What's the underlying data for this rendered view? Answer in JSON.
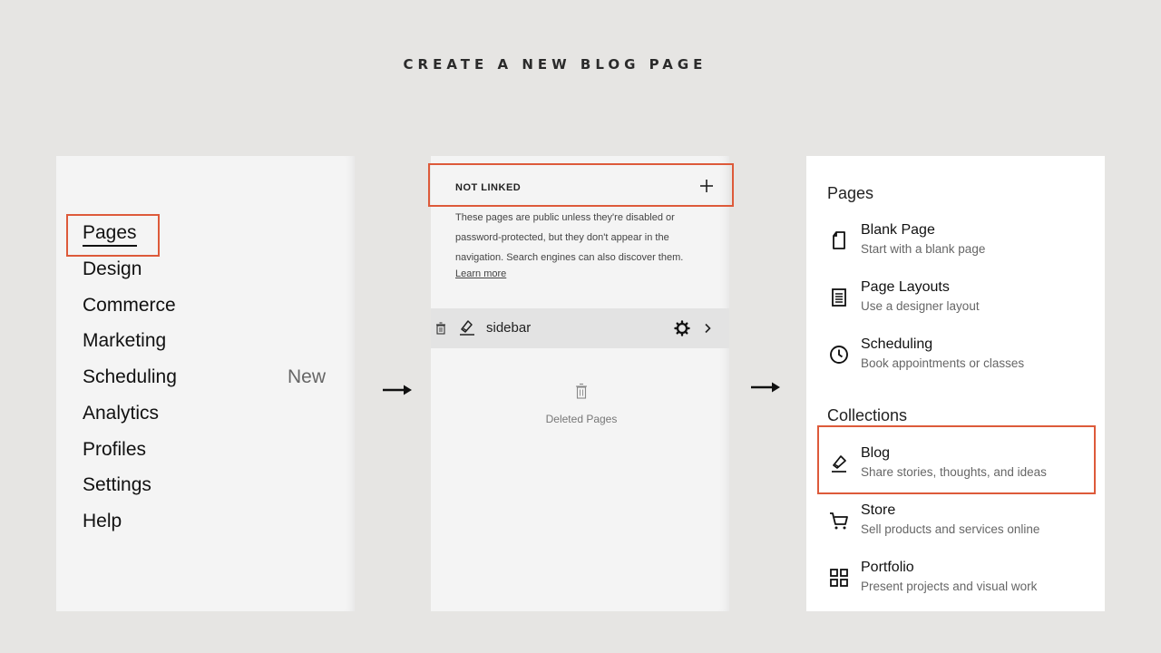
{
  "header": {
    "title": "CREATE A NEW BLOG PAGE"
  },
  "panel1": {
    "nav": [
      {
        "label": "Pages"
      },
      {
        "label": "Design"
      },
      {
        "label": "Commerce"
      },
      {
        "label": "Marketing"
      },
      {
        "label": "Scheduling",
        "badge": "New"
      },
      {
        "label": "Analytics"
      },
      {
        "label": "Profiles"
      },
      {
        "label": "Settings"
      },
      {
        "label": "Help"
      }
    ]
  },
  "panel2": {
    "section_title": "NOT LINKED",
    "description": "These pages are public unless they're disabled or password-protected, but they don't appear in the navigation. Search engines can also discover them.",
    "learn_more": "Learn more",
    "page_row": {
      "label": "sidebar"
    },
    "deleted_label": "Deleted Pages"
  },
  "panel3": {
    "pages_title": "Pages",
    "pages": [
      {
        "title": "Blank Page",
        "subtitle": "Start with a blank page",
        "icon": "blank-page-icon"
      },
      {
        "title": "Page Layouts",
        "subtitle": "Use a designer layout",
        "icon": "page-layouts-icon"
      },
      {
        "title": "Scheduling",
        "subtitle": "Book appointments or classes",
        "icon": "clock-icon"
      }
    ],
    "collections_title": "Collections",
    "collections": [
      {
        "title": "Blog",
        "subtitle": "Share stories, thoughts, and ideas",
        "icon": "blog-icon"
      },
      {
        "title": "Store",
        "subtitle": "Sell products and services online",
        "icon": "cart-icon"
      },
      {
        "title": "Portfolio",
        "subtitle": "Present projects and visual work",
        "icon": "grid-icon"
      }
    ]
  },
  "colors": {
    "highlight": "#dd5a3a",
    "background": "#e6e5e3",
    "panel": "#f4f4f4"
  }
}
